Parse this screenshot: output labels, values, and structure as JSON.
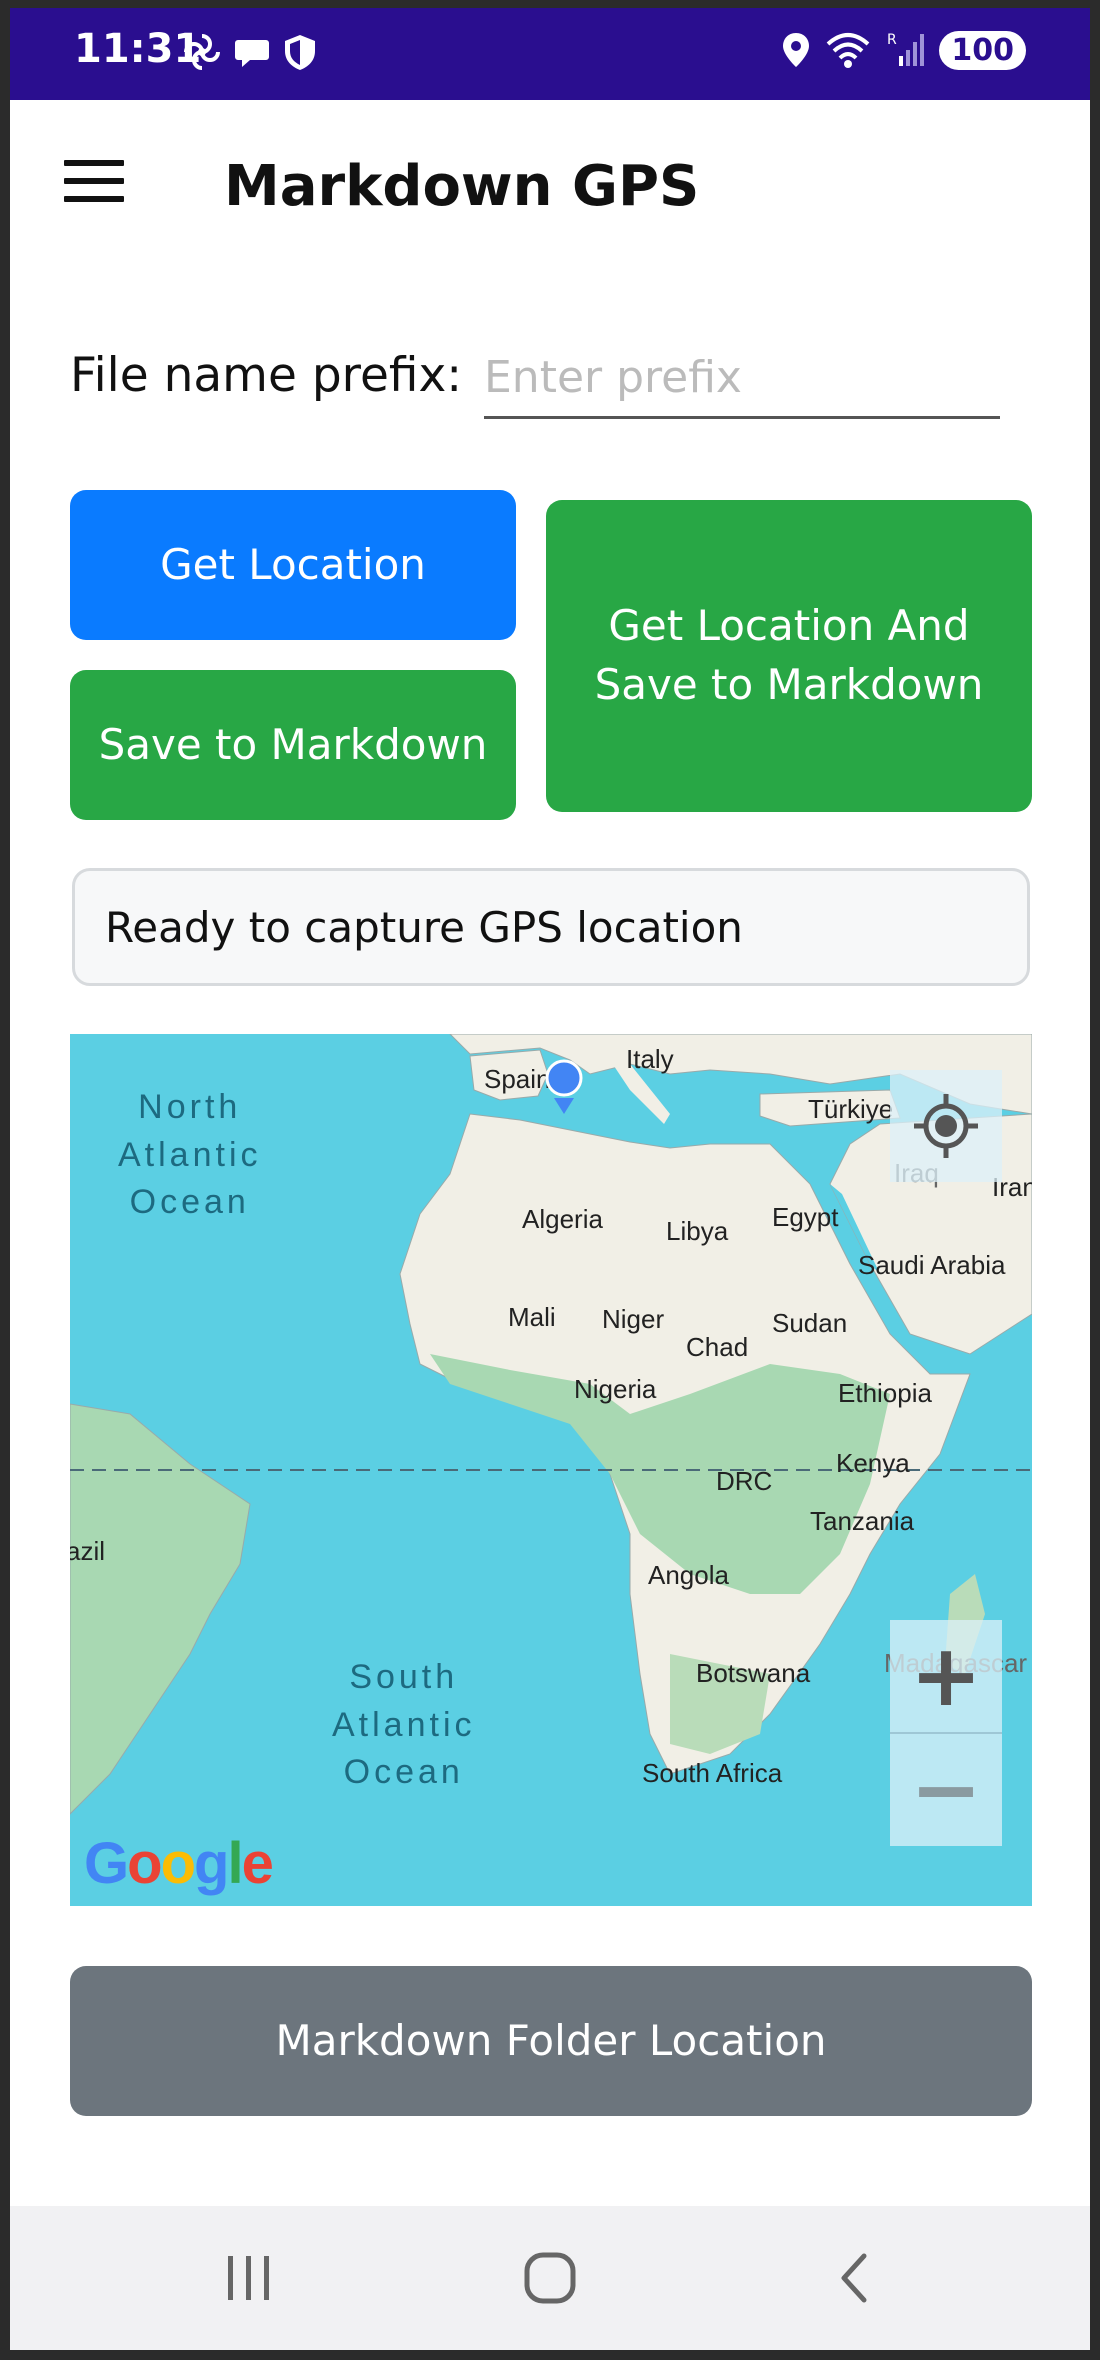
{
  "status_bar": {
    "time": "11:31",
    "battery": "100",
    "background_color": "#2a0e8f",
    "left_icons": [
      "pinwheel-icon",
      "chat-bubble-icon",
      "shield-icon"
    ],
    "right_icons": [
      "location-icon",
      "wifi-icon",
      "signal-icon"
    ]
  },
  "app_bar": {
    "title": "Markdown GPS",
    "menu_icon": "hamburger-menu-icon"
  },
  "prefix": {
    "label": "File name prefix:",
    "value": "",
    "placeholder": "Enter prefix"
  },
  "buttons": {
    "get_location": "Get Location",
    "save_markdown": "Save to Markdown",
    "get_and_save_line1": "Get Location And",
    "get_and_save_line2": "Save to Markdown",
    "folder_location": "Markdown Folder Location"
  },
  "colors": {
    "primary_blue": "#0a7bff",
    "success_green": "#28a745",
    "secondary_gray": "#6c757d",
    "map_water": "#5bcfe3"
  },
  "status_message": "Ready to capture GPS location",
  "map": {
    "oceans": {
      "north_atlantic": [
        "North",
        "Atlantic",
        "Ocean"
      ],
      "south_atlantic": [
        "South",
        "Atlantic",
        "Ocean"
      ]
    },
    "countries": {
      "spain": "Spain",
      "italy": "Italy",
      "turkiye": "Türkiye",
      "iraq": "Iraq",
      "iran": "Iran",
      "algeria": "Algeria",
      "libya": "Libya",
      "egypt": "Egypt",
      "saudi_arabia": "Saudi Arabia",
      "mali": "Mali",
      "niger": "Niger",
      "chad": "Chad",
      "sudan": "Sudan",
      "nigeria": "Nigeria",
      "ethiopia": "Ethiopia",
      "kenya": "Kenya",
      "drc": "DRC",
      "tanzania": "Tanzania",
      "brazil": "Brazil",
      "angola": "Angola",
      "botswana": "Botswana",
      "madagascar": "Madagascar",
      "south_africa": "South Africa"
    },
    "attribution": "Google",
    "controls": {
      "locate_icon": "my-location-icon",
      "zoom_in": "+",
      "zoom_out": "−"
    }
  },
  "nav_bar": {
    "recents_icon": "recents-icon",
    "home_icon": "home-icon",
    "back_icon": "back-icon"
  }
}
